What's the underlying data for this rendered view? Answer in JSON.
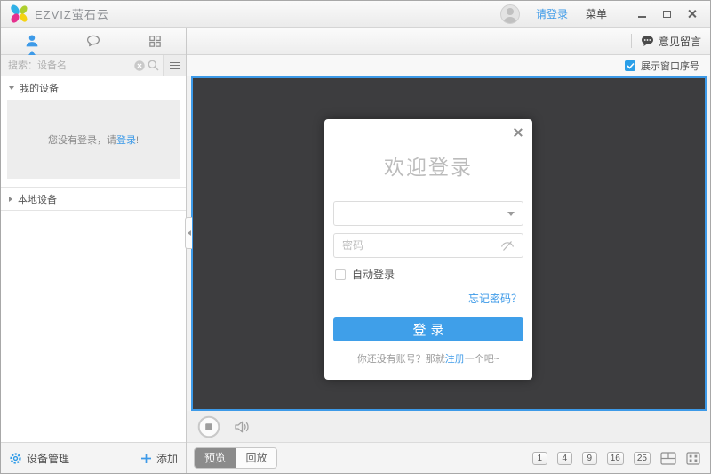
{
  "titlebar": {
    "app_name": "EZVIZ萤石云",
    "login_link": "请登录",
    "menu_label": "菜单"
  },
  "sidebar": {
    "search_placeholder": "搜索：设备名",
    "my_devices_label": "我的设备",
    "notice_prefix": "您没有登录，请",
    "notice_link": "登录",
    "notice_suffix": "!",
    "local_devices_label": "本地设备",
    "device_management_label": "设备管理",
    "add_label": "添加"
  },
  "toolbar": {
    "feedback_label": "意见留言",
    "show_window_number_label": "展示窗口序号",
    "show_window_number_checked": true
  },
  "login_dialog": {
    "title": "欢迎登录",
    "password_placeholder": "密码",
    "auto_login_label": "自动登录",
    "auto_login_checked": false,
    "forgot_password_link": "忘记密码？",
    "login_button_label": "登录",
    "register_prefix": "你还没有账号？那就",
    "register_link": "注册",
    "register_suffix": "一个吧~"
  },
  "bottom_bar": {
    "tabs": [
      {
        "label": "预览",
        "active": true
      },
      {
        "label": "回放",
        "active": false
      }
    ],
    "layout_buttons": [
      "1",
      "4",
      "9",
      "16",
      "25"
    ]
  },
  "colors": {
    "accent_blue": "#3d9ae8",
    "button_blue": "#3f9fe9",
    "video_background": "#3d3d3f",
    "video_border": "#3d9ae8",
    "active_view_tab": "#8b8b8b"
  }
}
